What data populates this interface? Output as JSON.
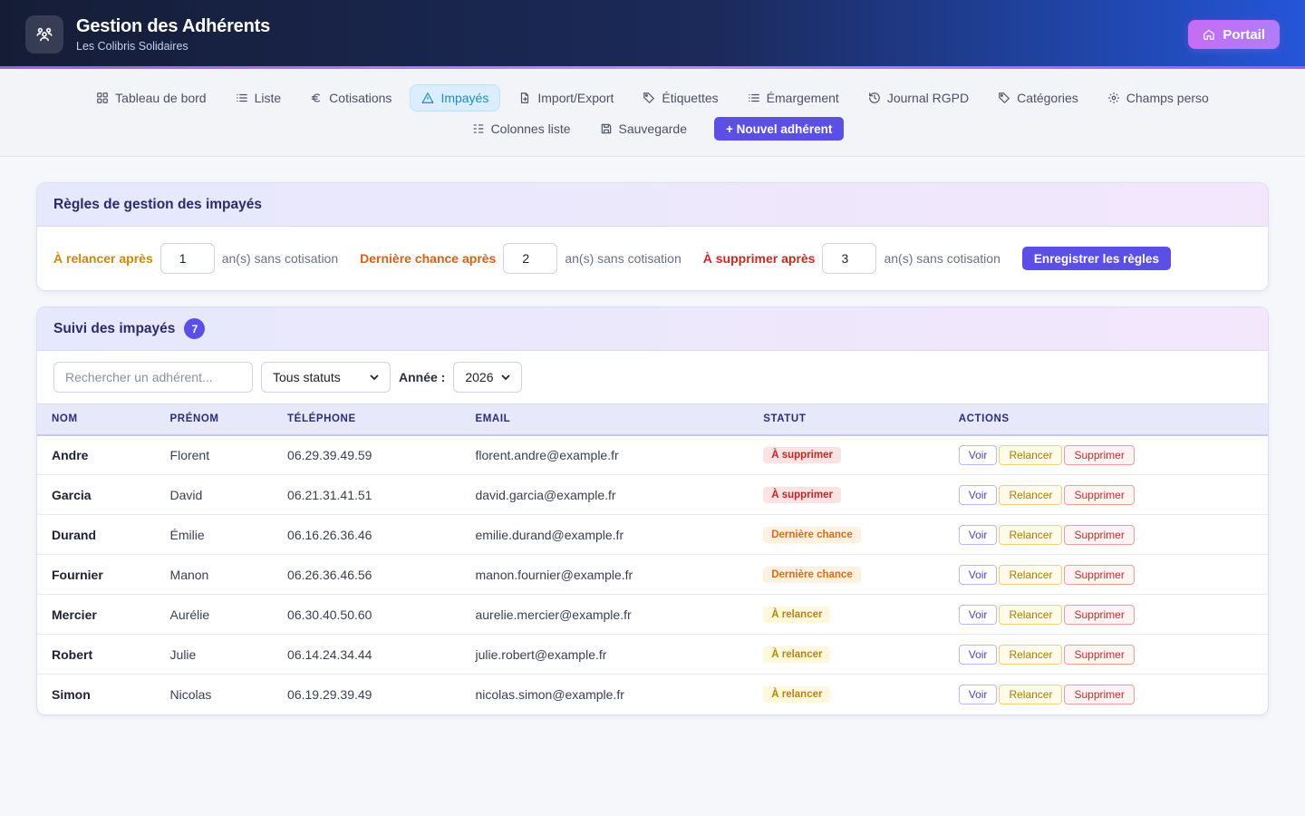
{
  "header": {
    "title": "Gestion des Adhérents",
    "subtitle": "Les Colibris Solidaires",
    "portal_label": "Portail"
  },
  "nav": {
    "row1": [
      {
        "label": "Tableau de bord",
        "icon": "grid-icon"
      },
      {
        "label": "Liste",
        "icon": "list-icon"
      },
      {
        "label": "Cotisations",
        "icon": "euro-icon"
      },
      {
        "label": "Impayés",
        "icon": "warning-icon",
        "active": true
      },
      {
        "label": "Import/Export",
        "icon": "file-export-icon"
      },
      {
        "label": "Étiquettes",
        "icon": "tag-icon"
      },
      {
        "label": "Émargement",
        "icon": "list-icon"
      },
      {
        "label": "Journal RGPD",
        "icon": "history-icon"
      },
      {
        "label": "Catégories",
        "icon": "tag-icon"
      },
      {
        "label": "Champs perso",
        "icon": "gear-icon"
      }
    ],
    "row2": [
      {
        "label": "Colonnes liste",
        "icon": "columns-icon"
      },
      {
        "label": "Sauvegarde",
        "icon": "save-icon"
      }
    ],
    "new_member_label": "+ Nouvel adhérent"
  },
  "rules": {
    "title": "Règles de gestion des impayés",
    "items": [
      {
        "label": "À relancer après",
        "value": "1",
        "suffix": "an(s) sans cotisation",
        "color": "#c98a06"
      },
      {
        "label": "Dernière chance après",
        "value": "2",
        "suffix": "an(s) sans cotisation",
        "color": "#e25d0e"
      },
      {
        "label": "À supprimer après",
        "value": "3",
        "suffix": "an(s) sans cotisation",
        "color": "#d12424"
      }
    ],
    "save_label": "Enregistrer les règles"
  },
  "tracking": {
    "title": "Suivi des impayés",
    "count": "7",
    "search_placeholder": "Rechercher un adhérent...",
    "status_select": "Tous statuts",
    "year_label": "Année :",
    "year_value": "2026",
    "columns": [
      "NOM",
      "PRÉNOM",
      "TÉLÉPHONE",
      "EMAIL",
      "STATUT",
      "ACTIONS"
    ],
    "actions": {
      "view": "Voir",
      "remind": "Relancer",
      "delete": "Supprimer"
    },
    "rows": [
      {
        "nom": "Andre",
        "prenom": "Florent",
        "tel": "06.29.39.49.59",
        "email": "florent.andre@example.fr",
        "statut": "À supprimer",
        "kind": "sup"
      },
      {
        "nom": "Garcia",
        "prenom": "David",
        "tel": "06.21.31.41.51",
        "email": "david.garcia@example.fr",
        "statut": "À supprimer",
        "kind": "sup"
      },
      {
        "nom": "Durand",
        "prenom": "Émilie",
        "tel": "06.16.26.36.46",
        "email": "emilie.durand@example.fr",
        "statut": "Dernière chance",
        "kind": "der"
      },
      {
        "nom": "Fournier",
        "prenom": "Manon",
        "tel": "06.26.36.46.56",
        "email": "manon.fournier@example.fr",
        "statut": "Dernière chance",
        "kind": "der"
      },
      {
        "nom": "Mercier",
        "prenom": "Aurélie",
        "tel": "06.30.40.50.60",
        "email": "aurelie.mercier@example.fr",
        "statut": "À relancer",
        "kind": "rel"
      },
      {
        "nom": "Robert",
        "prenom": "Julie",
        "tel": "06.14.24.34.44",
        "email": "julie.robert@example.fr",
        "statut": "À relancer",
        "kind": "rel"
      },
      {
        "nom": "Simon",
        "prenom": "Nicolas",
        "tel": "06.19.29.39.49",
        "email": "nicolas.simon@example.fr",
        "statut": "À relancer",
        "kind": "rel"
      }
    ]
  }
}
